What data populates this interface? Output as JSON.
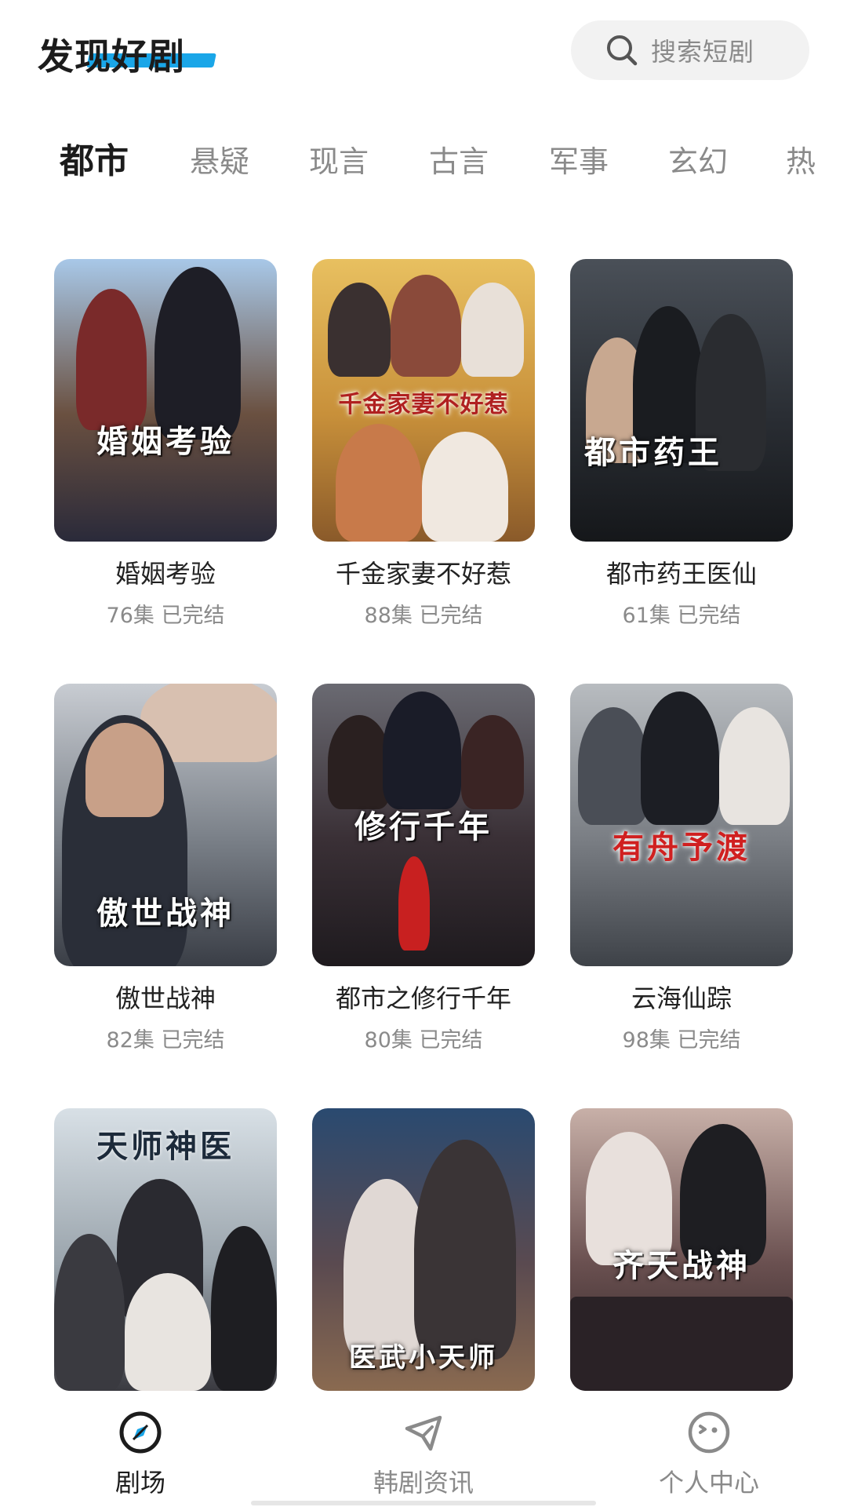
{
  "header": {
    "title": "发现好剧",
    "search_placeholder": "搜索短剧",
    "accent_color": "#1aa6e8"
  },
  "tabs": [
    {
      "label": "都市",
      "active": true
    },
    {
      "label": "悬疑",
      "active": false
    },
    {
      "label": "现言",
      "active": false
    },
    {
      "label": "古言",
      "active": false
    },
    {
      "label": "军事",
      "active": false
    },
    {
      "label": "玄幻",
      "active": false
    },
    {
      "label": "热",
      "active": false
    }
  ],
  "dramas": [
    {
      "name": "婚姻考验",
      "episodes": "76集",
      "status": "已完结",
      "poster_text": "婚姻考验",
      "poster_colors": [
        "#a8c8e8",
        "#6a5040",
        "#2a2a3a"
      ]
    },
    {
      "name": "千金家妻不好惹",
      "episodes": "88集",
      "status": "已完结",
      "poster_text": "千金家妻不好惹",
      "poster_colors": [
        "#e8c060",
        "#c8903a",
        "#8a5a2a"
      ]
    },
    {
      "name": "都市药王医仙",
      "episodes": "61集",
      "status": "已完结",
      "poster_text": "都市药王",
      "poster_colors": [
        "#4a5058",
        "#2a2e34",
        "#15171a"
      ]
    },
    {
      "name": "傲世战神",
      "episodes": "82集",
      "status": "已完结",
      "poster_text": "傲世战神",
      "poster_colors": [
        "#c8ccd2",
        "#7a8088",
        "#3a3e46"
      ]
    },
    {
      "name": "都市之修行千年",
      "episodes": "80集",
      "status": "已完结",
      "poster_text": "修行千年",
      "poster_colors": [
        "#6a6a72",
        "#3a3036",
        "#1e1a1e"
      ]
    },
    {
      "name": "云海仙踪",
      "episodes": "98集",
      "status": "已完结",
      "poster_text": "有舟予渡",
      "poster_colors": [
        "#b8bcc0",
        "#7a7e84",
        "#3e4248"
      ]
    },
    {
      "name": "",
      "episodes": "",
      "status": "",
      "poster_text": "天师神医",
      "poster_colors": [
        "#d8e0e6",
        "#9aa4ac",
        "#3a3a40"
      ]
    },
    {
      "name": "",
      "episodes": "",
      "status": "",
      "poster_text": "医武小天师",
      "poster_colors": [
        "#2a4a70",
        "#5a4a50",
        "#8a6a50"
      ]
    },
    {
      "name": "",
      "episodes": "",
      "status": "",
      "poster_text": "齐天战神",
      "poster_colors": [
        "#c8b0a8",
        "#6a5050",
        "#2a2224"
      ]
    }
  ],
  "bottom_nav": [
    {
      "label": "剧场",
      "icon": "compass-icon",
      "active": true
    },
    {
      "label": "韩剧资讯",
      "icon": "send-icon",
      "active": false
    },
    {
      "label": "个人中心",
      "icon": "face-icon",
      "active": false
    }
  ]
}
